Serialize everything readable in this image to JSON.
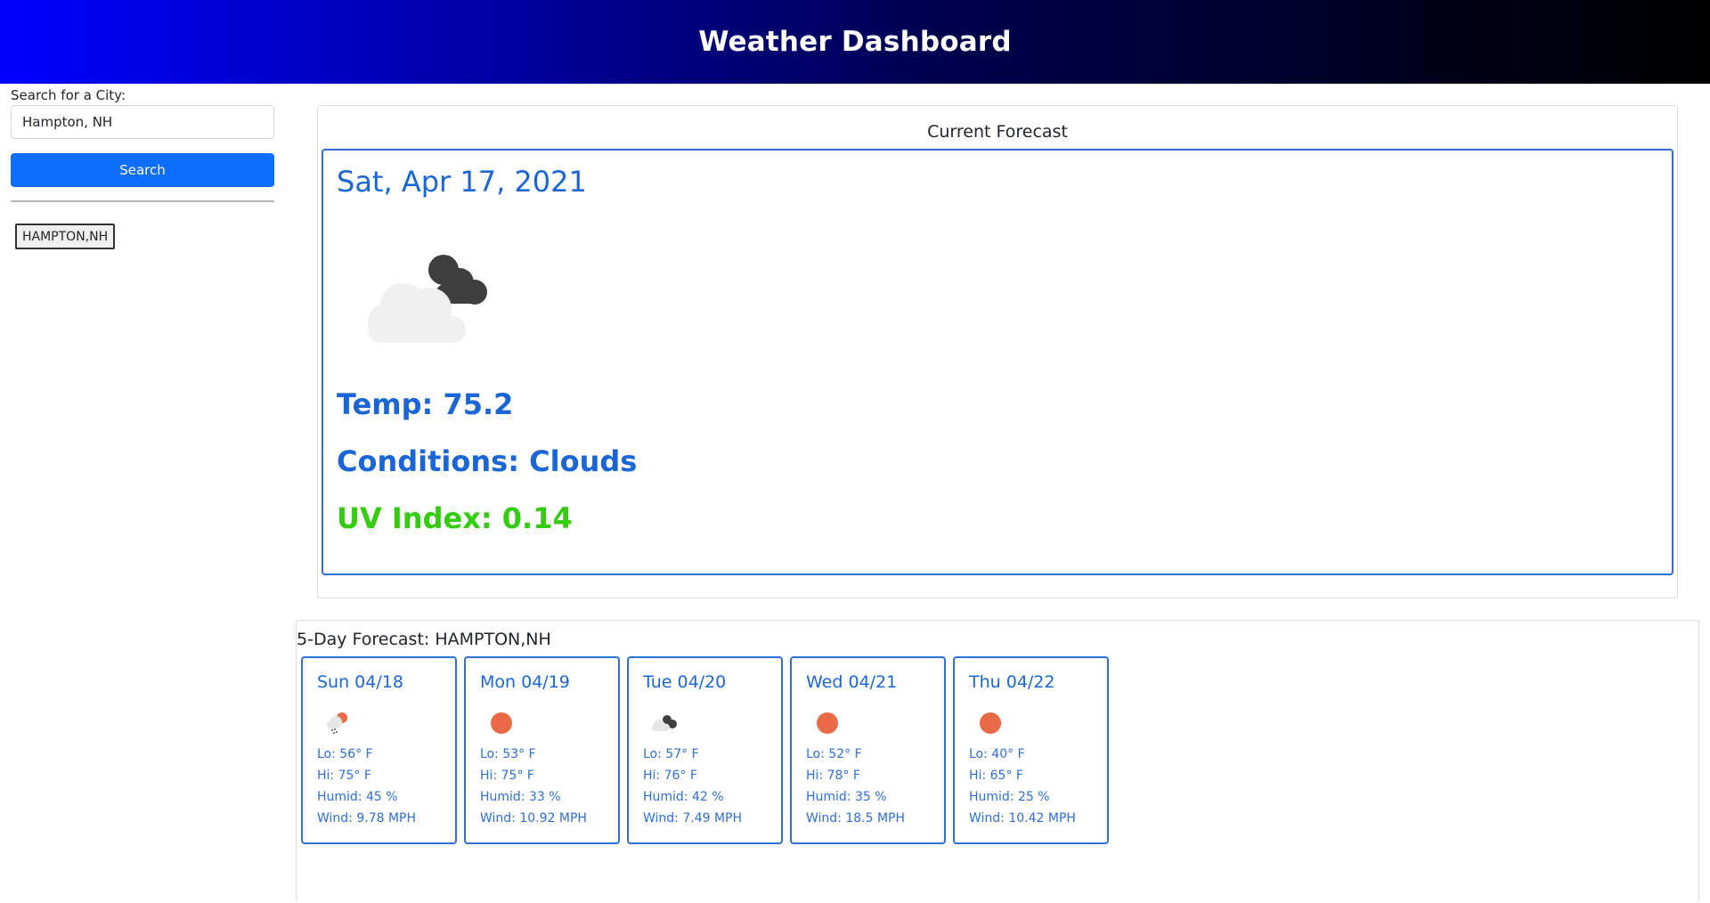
{
  "header": {
    "title": "Weather Dashboard"
  },
  "search": {
    "label": "Search for a City:",
    "value": "Hampton, NH",
    "button_label": "Search"
  },
  "history": [
    {
      "label": "HAMPTON,NH"
    }
  ],
  "current": {
    "section_title": "Current Forecast",
    "date": "Sat, Apr 17, 2021",
    "icon": "partly-cloudy-icon",
    "temp": "Temp: 75.2",
    "conditions": "Conditions: Clouds",
    "uv": "UV Index: 0.14",
    "colors": {
      "accent": "#1a66d6",
      "uv_low": "#33cc11"
    }
  },
  "forecast": {
    "title": "5-Day Forecast: HAMPTON,NH",
    "days": [
      {
        "date": "Sun 04/18",
        "icon": "rain-sun-icon",
        "lo": "Lo: 56° F",
        "hi": "Hi: 75° F",
        "humid": "Humid: 45 %",
        "wind": "Wind: 9.78 MPH"
      },
      {
        "date": "Mon 04/19",
        "icon": "sun-icon",
        "lo": "Lo: 53° F",
        "hi": "Hi: 75° F",
        "humid": "Humid: 33 %",
        "wind": "Wind: 10.92 MPH"
      },
      {
        "date": "Tue 04/20",
        "icon": "cloudy-icon",
        "lo": "Lo: 57° F",
        "hi": "Hi: 76° F",
        "humid": "Humid: 42 %",
        "wind": "Wind: 7.49 MPH"
      },
      {
        "date": "Wed 04/21",
        "icon": "sun-icon",
        "lo": "Lo: 52° F",
        "hi": "Hi: 78° F",
        "humid": "Humid: 35 %",
        "wind": "Wind: 18.5 MPH"
      },
      {
        "date": "Thu 04/22",
        "icon": "sun-icon",
        "lo": "Lo: 40° F",
        "hi": "Hi: 65° F",
        "humid": "Humid: 25 %",
        "wind": "Wind: 10.42 MPH"
      }
    ]
  }
}
